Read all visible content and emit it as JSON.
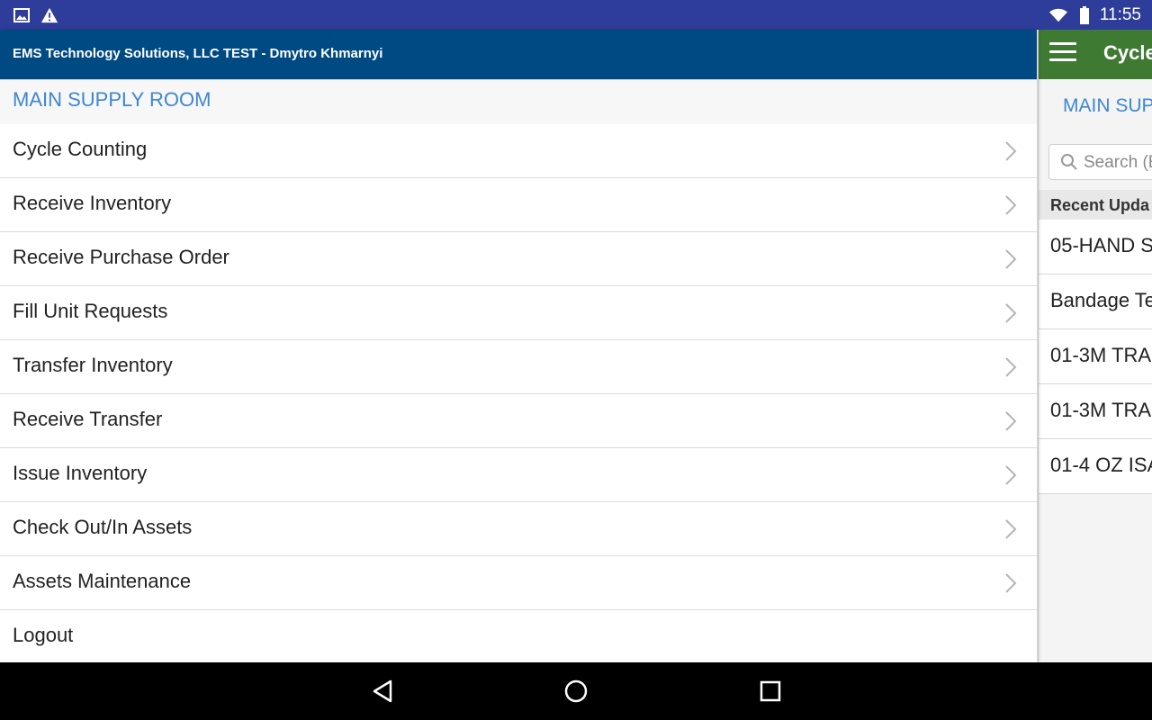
{
  "status_bar": {
    "time": "11:55",
    "icons": [
      "image-icon",
      "warning-icon",
      "wifi-icon",
      "battery-icon"
    ]
  },
  "drawer": {
    "header_title": "EMS Technology Solutions, LLC TEST - Dmytro Khmarnyi",
    "location": "MAIN SUPPLY ROOM",
    "items": [
      {
        "label": "Cycle Counting"
      },
      {
        "label": "Receive Inventory"
      },
      {
        "label": "Receive Purchase Order"
      },
      {
        "label": "Fill Unit Requests"
      },
      {
        "label": "Transfer Inventory"
      },
      {
        "label": "Receive Transfer"
      },
      {
        "label": "Issue Inventory"
      },
      {
        "label": "Check Out/In Assets"
      },
      {
        "label": "Assets Maintenance"
      },
      {
        "label": "Logout"
      }
    ]
  },
  "panel": {
    "title": "Cycle",
    "location": "MAIN SUP",
    "search_placeholder": "Search (E",
    "section_label": "Recent Upda",
    "rows": [
      "05-HAND S",
      "Bandage Te",
      "01-3M TRA",
      "01-3M TRA",
      "01-4 OZ ISA"
    ]
  },
  "colors": {
    "status_bar": "#2f3d9a",
    "drawer_header": "#004a83",
    "panel_toolbar": "#3f7a33",
    "location_text": "#3d87d0"
  }
}
